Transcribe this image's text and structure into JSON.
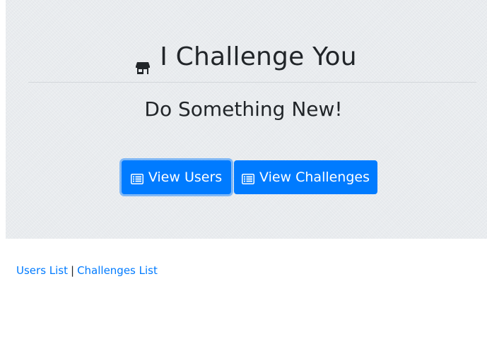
{
  "hero": {
    "title": "I Challenge You",
    "title_icon": "store-icon",
    "subtitle": "Do Something New!"
  },
  "buttons": {
    "view_users_label": "View Users",
    "view_challenges_label": "View Challenges",
    "icon": "list-alt-icon"
  },
  "links": {
    "users_list": "Users List",
    "separator": "|",
    "challenges_list": "Challenges List"
  },
  "colors": {
    "primary": "#007bff",
    "jumbotron_bg": "#e9ecef",
    "text": "#212529"
  }
}
